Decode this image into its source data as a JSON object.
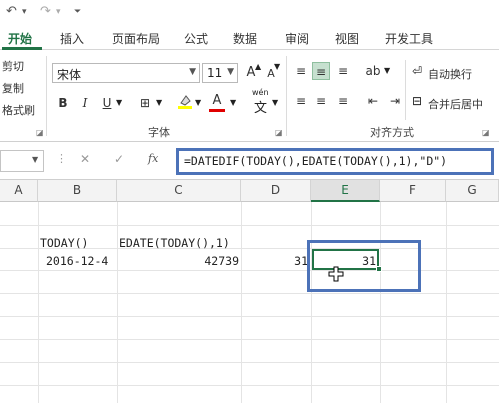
{
  "quick_access": {
    "undo": "↶",
    "redo": "↷",
    "customize": "⏷"
  },
  "tabs": [
    "开始",
    "插入",
    "页面布局",
    "公式",
    "数据",
    "审阅",
    "视图",
    "开发工具"
  ],
  "ribbon": {
    "clipboard": {
      "cut": "剪切",
      "copy": "复制",
      "format_painter": "格式刷"
    },
    "font": {
      "name": "宋体",
      "size": "11",
      "grow": "A",
      "shrink": "A",
      "bold": "B",
      "italic": "I",
      "underline": "U",
      "wen": "wén",
      "wen_char": "文",
      "group_label": "字体"
    },
    "alignment": {
      "wrap_text": "自动换行",
      "merge_center": "合并后居中",
      "group_label": "对齐方式"
    }
  },
  "formula_bar": {
    "fx": "fx",
    "cancel": "✕",
    "enter": "✓",
    "formula": "=DATEDIF(TODAY(),EDATE(TODAY(),1),\"D\")"
  },
  "grid": {
    "columns": [
      "A",
      "B",
      "C",
      "D",
      "E",
      "F",
      "G"
    ],
    "selected_column": "E",
    "cells": {
      "b_header": "TODAY()",
      "c_header": "EDATE(TODAY(),1)",
      "b_value": "2016-12-4",
      "c_value": "42739",
      "d_value": "31",
      "e_value": "31"
    }
  },
  "colors": {
    "accent": "#217346",
    "highlight_box": "#4c72b8"
  }
}
